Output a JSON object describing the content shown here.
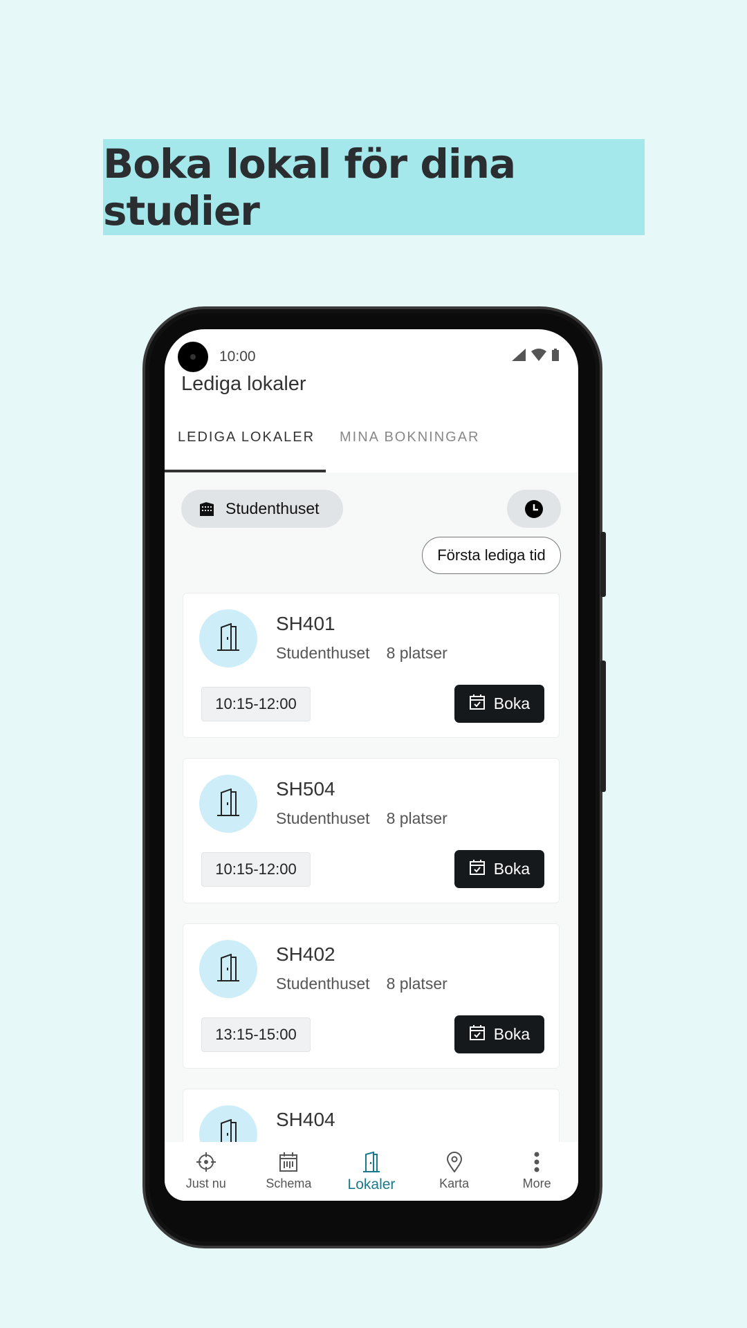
{
  "banner": {
    "title": "Boka lokal för dina studier"
  },
  "status": {
    "time": "10:00"
  },
  "header": {
    "title": "Lediga lokaler"
  },
  "tabs": [
    {
      "label": "LEDIGA LOKALER",
      "active": true
    },
    {
      "label": "MINA BOKNINGAR",
      "active": false
    }
  ],
  "filters": {
    "building": "Studenthuset",
    "first_available": "Första lediga tid"
  },
  "rooms": [
    {
      "name": "SH401",
      "building": "Studenthuset",
      "seats": "8 platser",
      "time": "10:15-12:00",
      "book": "Boka"
    },
    {
      "name": "SH504",
      "building": "Studenthuset",
      "seats": "8 platser",
      "time": "10:15-12:00",
      "book": "Boka"
    },
    {
      "name": "SH402",
      "building": "Studenthuset",
      "seats": "8 platser",
      "time": "13:15-15:00",
      "book": "Boka"
    },
    {
      "name": "SH404"
    }
  ],
  "nav": [
    {
      "label": "Just nu",
      "icon": "crosshair-icon"
    },
    {
      "label": "Schema",
      "icon": "calendar-icon"
    },
    {
      "label": "Lokaler",
      "icon": "door-icon",
      "active": true
    },
    {
      "label": "Karta",
      "icon": "map-pin-icon"
    },
    {
      "label": "More",
      "icon": "more-vertical-icon"
    }
  ],
  "colors": {
    "background": "#e6f8f8",
    "banner": "#a5e8ec",
    "accent": "#19788a",
    "button": "#15191c",
    "room_icon_bg": "#cdeef8"
  }
}
